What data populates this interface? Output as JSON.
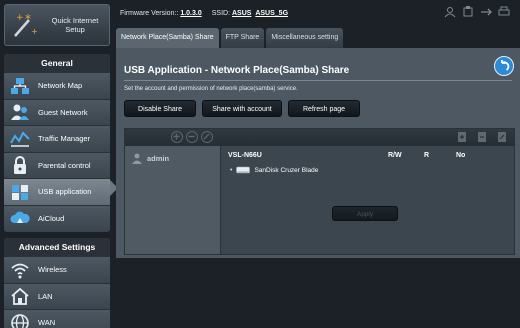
{
  "topbar": {
    "firmware_label": "Firmware Version::",
    "firmware_value": "1.0.3.0",
    "ssid_label": "SSID:",
    "ssid_1": "ASUS",
    "ssid_2": "ASUS_5G"
  },
  "sidebar": {
    "qis_label": "Quick Internet Setup",
    "general_title": "General",
    "general_items": [
      {
        "label": "Network Map",
        "icon": "network-map-icon"
      },
      {
        "label": "Guest Network",
        "icon": "guest-network-icon"
      },
      {
        "label": "Traffic Manager",
        "icon": "traffic-manager-icon"
      },
      {
        "label": "Parental control",
        "icon": "lock-icon"
      },
      {
        "label": "USB application",
        "icon": "puzzle-icon",
        "active": true
      },
      {
        "label": "AiCloud",
        "icon": "cloud-icon"
      }
    ],
    "advanced_title": "Advanced Settings",
    "advanced_items": [
      {
        "label": "Wireless",
        "icon": "wifi-icon"
      },
      {
        "label": "LAN",
        "icon": "home-icon"
      },
      {
        "label": "WAN",
        "icon": "globe-icon"
      }
    ]
  },
  "tabs": [
    {
      "label": "Network Place(Samba) Share",
      "active": true
    },
    {
      "label": "FTP Share",
      "active": false
    },
    {
      "label": "Miscellaneous setting",
      "active": false
    }
  ],
  "panel": {
    "title": "USB Application - Network Place(Samba) Share",
    "description": "Set the account and permission of network place(samba) service.",
    "btn_disable": "Disable Share",
    "btn_share_account": "Share with account",
    "btn_refresh": "Refresh page"
  },
  "accounts": [
    "admin"
  ],
  "share": {
    "host": "VSL-N66U",
    "col_rw": "R/W",
    "col_r": "R",
    "col_no": "No",
    "disk": "SanDisk Cruzer Blade",
    "apply": "Apply"
  },
  "colors": {
    "background": "#1c2127",
    "panel": "#4d5862",
    "active_item": "#6b7781",
    "accent_blue": "#2c8ad6"
  }
}
